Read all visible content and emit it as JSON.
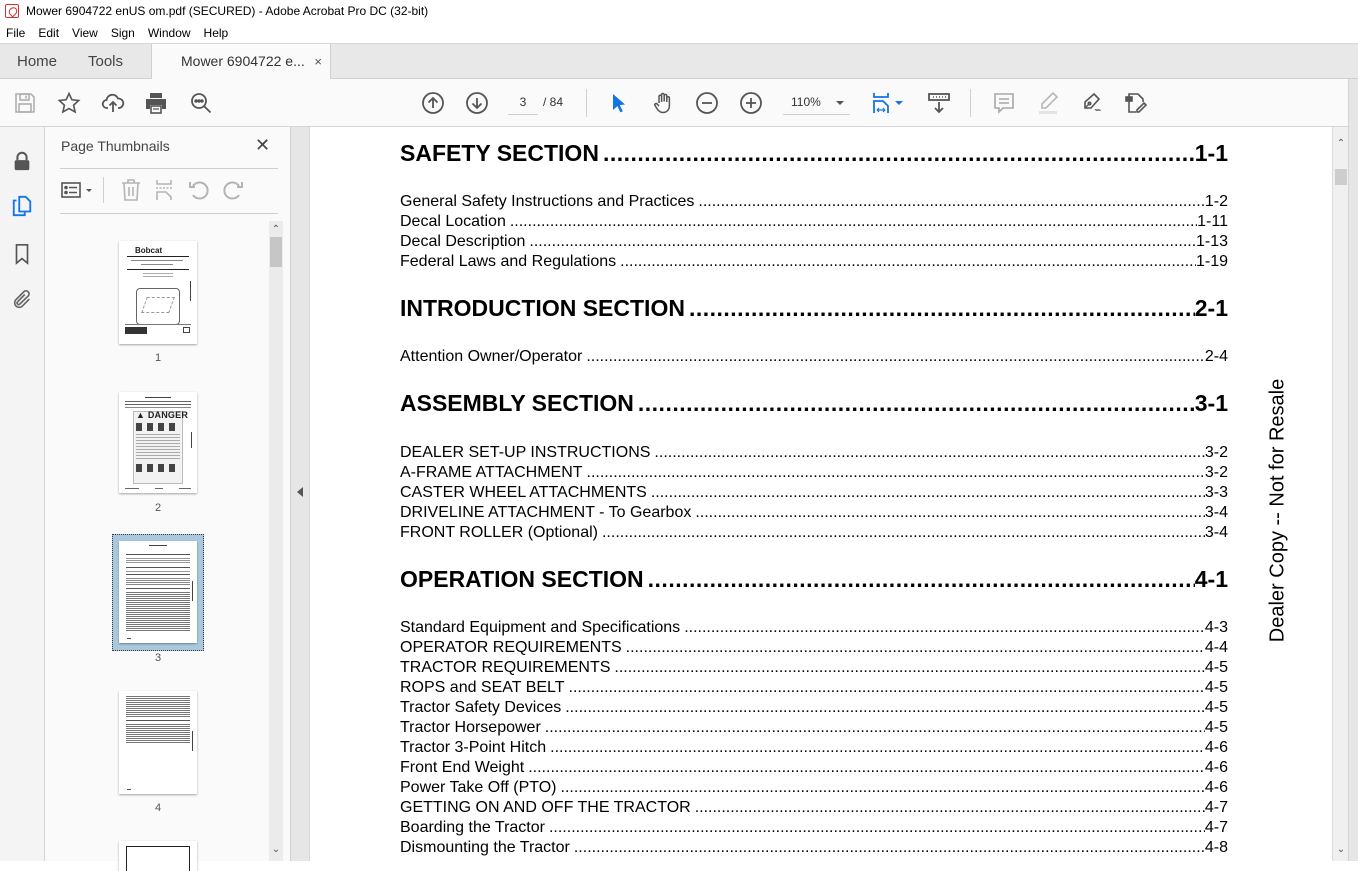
{
  "window": {
    "title": "Mower 6904722 enUS om.pdf (SECURED) - Adobe Acrobat Pro DC (32-bit)",
    "app_icon": "acrobat-icon"
  },
  "menu": [
    "File",
    "Edit",
    "View",
    "Sign",
    "Window",
    "Help"
  ],
  "tabs": {
    "home": "Home",
    "tools": "Tools",
    "document": "Mower 6904722 e...",
    "close_glyph": "×"
  },
  "toolbar": {
    "current_page": "3",
    "total_pages": "/ 84",
    "zoom": "110%",
    "icons": [
      "save-icon",
      "bookmark-star-icon",
      "upload-icon",
      "print-icon",
      "search-zoom-icon",
      "previous-page-icon",
      "next-page-icon",
      "select-cursor-icon",
      "hand-tool-icon",
      "zoom-out-icon",
      "zoom-in-icon",
      "page-fit-icon",
      "scroll-mode-icon",
      "comment-icon",
      "highlight-icon",
      "sign-icon",
      "edit-pdf-icon"
    ],
    "accent_color": "#1473e6"
  },
  "left_rail": [
    "lock-icon",
    "page-thumbnails-icon",
    "bookmark-icon",
    "attachment-icon"
  ],
  "thumbnails_panel": {
    "title": "Page Thumbnails",
    "close_glyph": "✕",
    "pages": [
      {
        "label": "1"
      },
      {
        "label": "2"
      },
      {
        "label": "3",
        "selected": true
      },
      {
        "label": "4"
      }
    ],
    "thumb1_brand": "Bobcat",
    "thumb2_banner": "DANGER"
  },
  "document": {
    "sections": [
      {
        "title": "SAFETY SECTION",
        "page": "1-1",
        "entries": [
          {
            "label": "General Safety Instructions and Practices",
            "page": "1-2"
          },
          {
            "label": "Decal Location",
            "page": "1-11"
          },
          {
            "label": "Decal Description",
            "page": "1-13"
          },
          {
            "label": "Federal Laws and Regulations",
            "page": "1-19"
          }
        ]
      },
      {
        "title": "INTRODUCTION SECTION",
        "page": "2-1",
        "entries": [
          {
            "label": "Attention Owner/Operator",
            "page": "2-4"
          }
        ]
      },
      {
        "title": "ASSEMBLY SECTION",
        "page": "3-1",
        "entries": [
          {
            "label": "DEALER SET-UP INSTRUCTIONS",
            "page": "3-2"
          },
          {
            "label": "A-FRAME ATTACHMENT",
            "page": "3-2"
          },
          {
            "label": "CASTER WHEEL ATTACHMENTS",
            "page": "3-3"
          },
          {
            "label": "DRIVELINE ATTACHMENT - To Gearbox",
            "page": "3-4"
          },
          {
            "label": "FRONT ROLLER (Optional)",
            "page": "3-4"
          }
        ]
      },
      {
        "title": "OPERATION SECTION",
        "page": "4-1",
        "entries": [
          {
            "label": "Standard Equipment and Specifications",
            "page": "4-3"
          },
          {
            "label": "OPERATOR REQUIREMENTS",
            "page": "4-4"
          },
          {
            "label": "TRACTOR REQUIREMENTS",
            "page": "4-5"
          },
          {
            "label": "ROPS and SEAT BELT",
            "page": "4-5"
          },
          {
            "label": "Tractor Safety Devices",
            "page": "4-5"
          },
          {
            "label": "Tractor Horsepower",
            "page": "4-5"
          },
          {
            "label": "Tractor 3-Point Hitch",
            "page": "4-6"
          },
          {
            "label": "Front End Weight",
            "page": "4-6"
          },
          {
            "label": "Power Take Off (PTO)",
            "page": "4-6"
          },
          {
            "label": "GETTING ON AND OFF THE TRACTOR",
            "page": "4-7"
          },
          {
            "label": "Boarding the Tractor",
            "page": "4-7"
          },
          {
            "label": "Dismounting the Tractor",
            "page": "4-8"
          }
        ]
      }
    ],
    "watermark": "Dealer Copy -- Not for Resale"
  }
}
